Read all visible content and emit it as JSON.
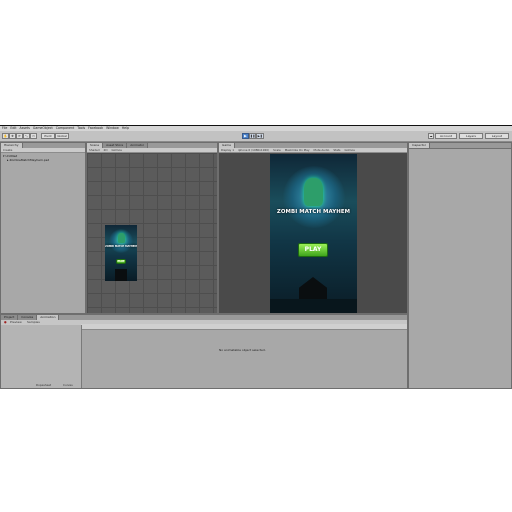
{
  "menu": [
    "File",
    "Edit",
    "Assets",
    "GameObject",
    "Component",
    "Tools",
    "Facebook",
    "Window",
    "Help"
  ],
  "toolbar": {
    "tools": [
      "✋",
      "✥",
      "⟳",
      "⤡",
      "▭"
    ],
    "pivot": "Pivot",
    "global": "Global",
    "play": "▶",
    "pause": "❚❚",
    "step": "▶❚",
    "account": "Account",
    "layers": "Layers",
    "layout": "Layout"
  },
  "hierarchy": {
    "tab": "Hierarchy",
    "create": "Create",
    "items": [
      "Untitled",
      "ZombieMatchMayhem.psd"
    ]
  },
  "scene": {
    "tabs": [
      "Scene",
      "Asset Store",
      "Animator"
    ],
    "shading": "Shaded",
    "mode": "2D",
    "gizmos": "Gizmos"
  },
  "game": {
    "tab": "Game",
    "display": "Display 1",
    "resolution": "iphone 6 (1080x1920)",
    "scale": "Scale",
    "toggles": [
      "Maximize On Play",
      "Mute Audio",
      "Stats",
      "Gizmos"
    ]
  },
  "inspector": {
    "tab": "Inspector"
  },
  "bottom": {
    "tabs": [
      "Project",
      "Console",
      "Animation"
    ],
    "preview": "Preview",
    "samples": "Samples",
    "message": "No animatable object selected.",
    "dopesheet": "Dopesheet",
    "curves": "Curves"
  },
  "game_art": {
    "title": "ZOMBI MATCH MAYHEM",
    "play_label": "PLAY",
    "colors": {
      "sky": "#0f2737",
      "glow": "#3fa0c0",
      "button": "#7ad842",
      "zombie": "#2d9e6a"
    }
  }
}
